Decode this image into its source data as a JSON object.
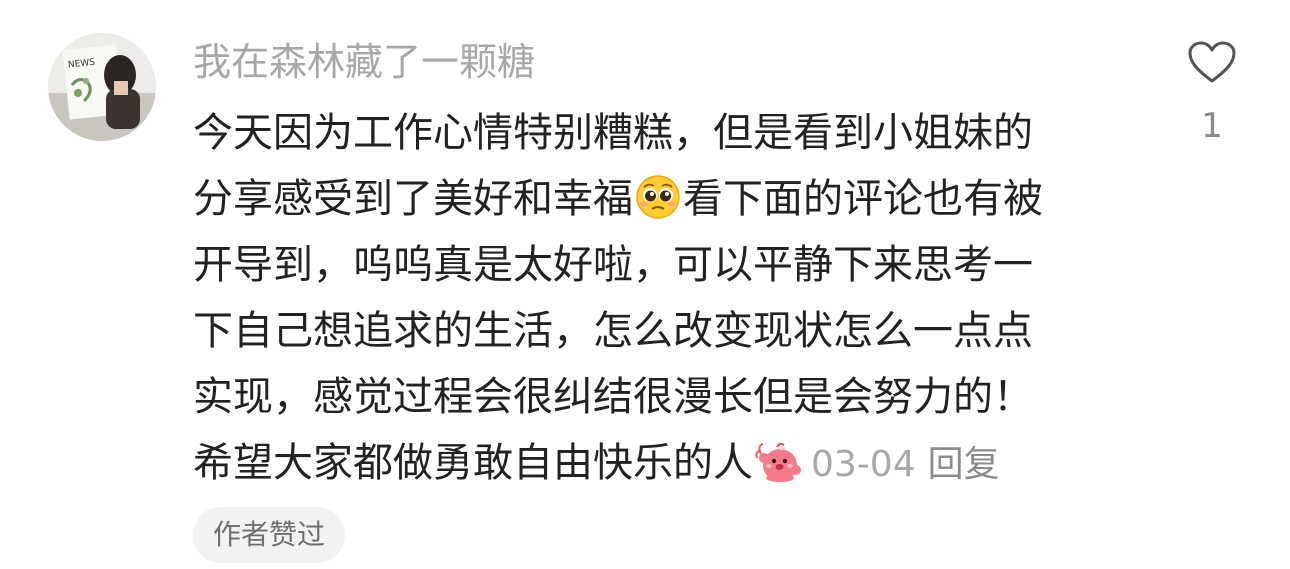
{
  "comment": {
    "username": "我在森林藏了一颗糖",
    "lines": [
      "今天因为工作心情特别糟糕，但是看到小姐妹的",
      "分享感受到了美好和幸福",
      "看下面的评论也有被",
      "开导到，呜呜真是太好啦，可以平静下来思考一",
      "下自己想追求的生活，怎么改变现状怎么一点点",
      "实现，感觉过程会很纠结很漫长但是会努力的！",
      "希望大家都做勇敢自由快乐的人"
    ],
    "emojis": {
      "pleading": "pleading-face-emoji",
      "waving": "pink-waving-sticker-emoji"
    },
    "date": "03-04",
    "reply_label": "回复",
    "author_badge": "作者赞过",
    "like_count": "1",
    "avatar_text": "NEWS"
  }
}
